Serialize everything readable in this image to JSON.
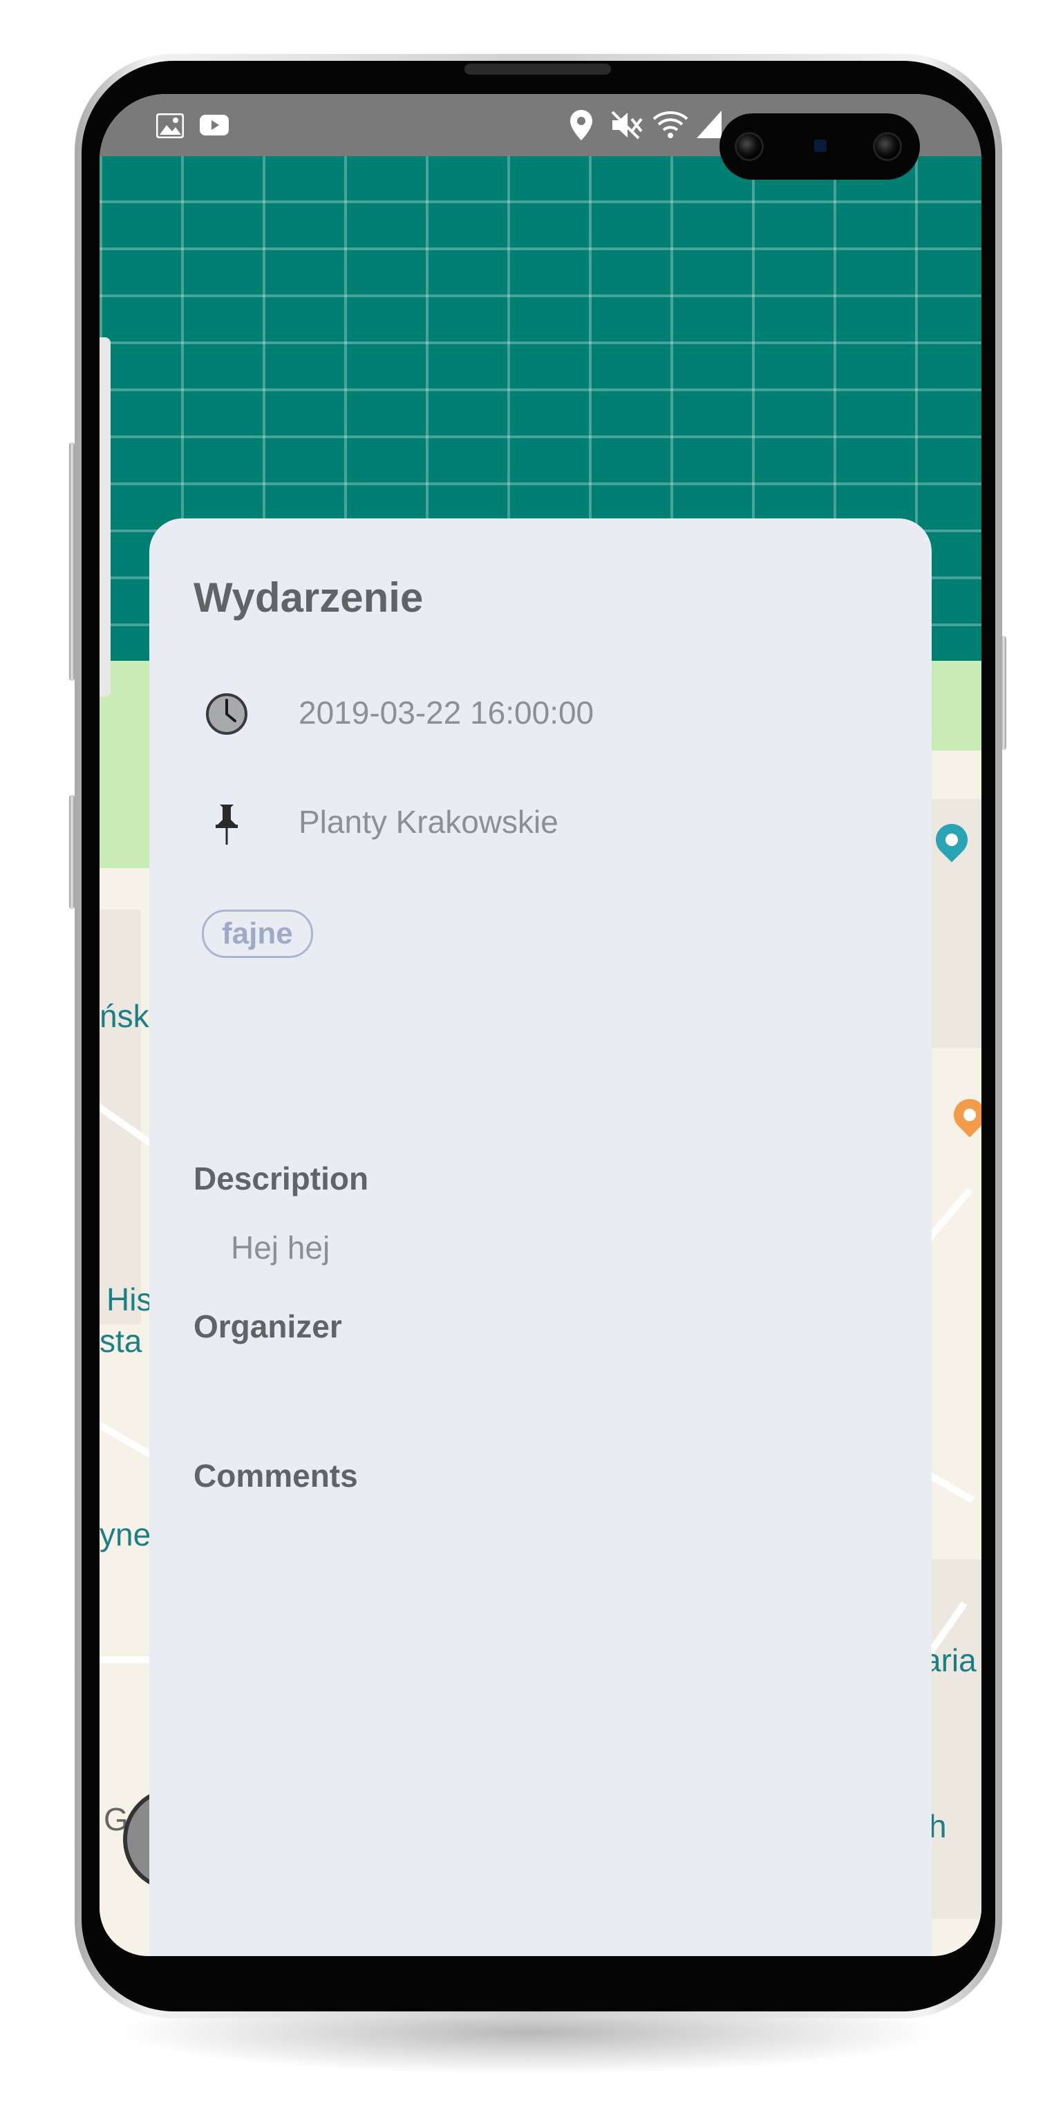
{
  "event": {
    "title": "Wydarzenie",
    "datetime": "2019-03-22 16:00:00",
    "location": "Planty Krakowskie",
    "tag": "fajne",
    "description_label": "Description",
    "description_text": "Hej hej",
    "organizer_label": "Organizer",
    "comments_label": "Comments"
  },
  "map_labels": {
    "left_1": "ńsk",
    "left_2": "His",
    "left_3": "sta",
    "left_4": "yne",
    "left_5": "G",
    "right_1": "aria",
    "right_2": "h"
  },
  "colors": {
    "header_teal": "#007f73",
    "sheet_bg": "#eaecf3",
    "title_text": "#616366",
    "muted_text": "#8e8f93",
    "tag_border": "#aab6d0",
    "map_label": "#1a7f86",
    "park_green": "#c9ecb6",
    "pin_teal": "#2aa3b5",
    "pin_orange": "#f29b4a"
  },
  "icons": {
    "time": "clock-icon",
    "location": "pushpin-icon",
    "status_left": [
      "image-icon",
      "youtube-icon"
    ],
    "status_right": [
      "location-icon",
      "mute-icon",
      "wifi-icon",
      "signal-icon",
      "battery-icon"
    ]
  }
}
